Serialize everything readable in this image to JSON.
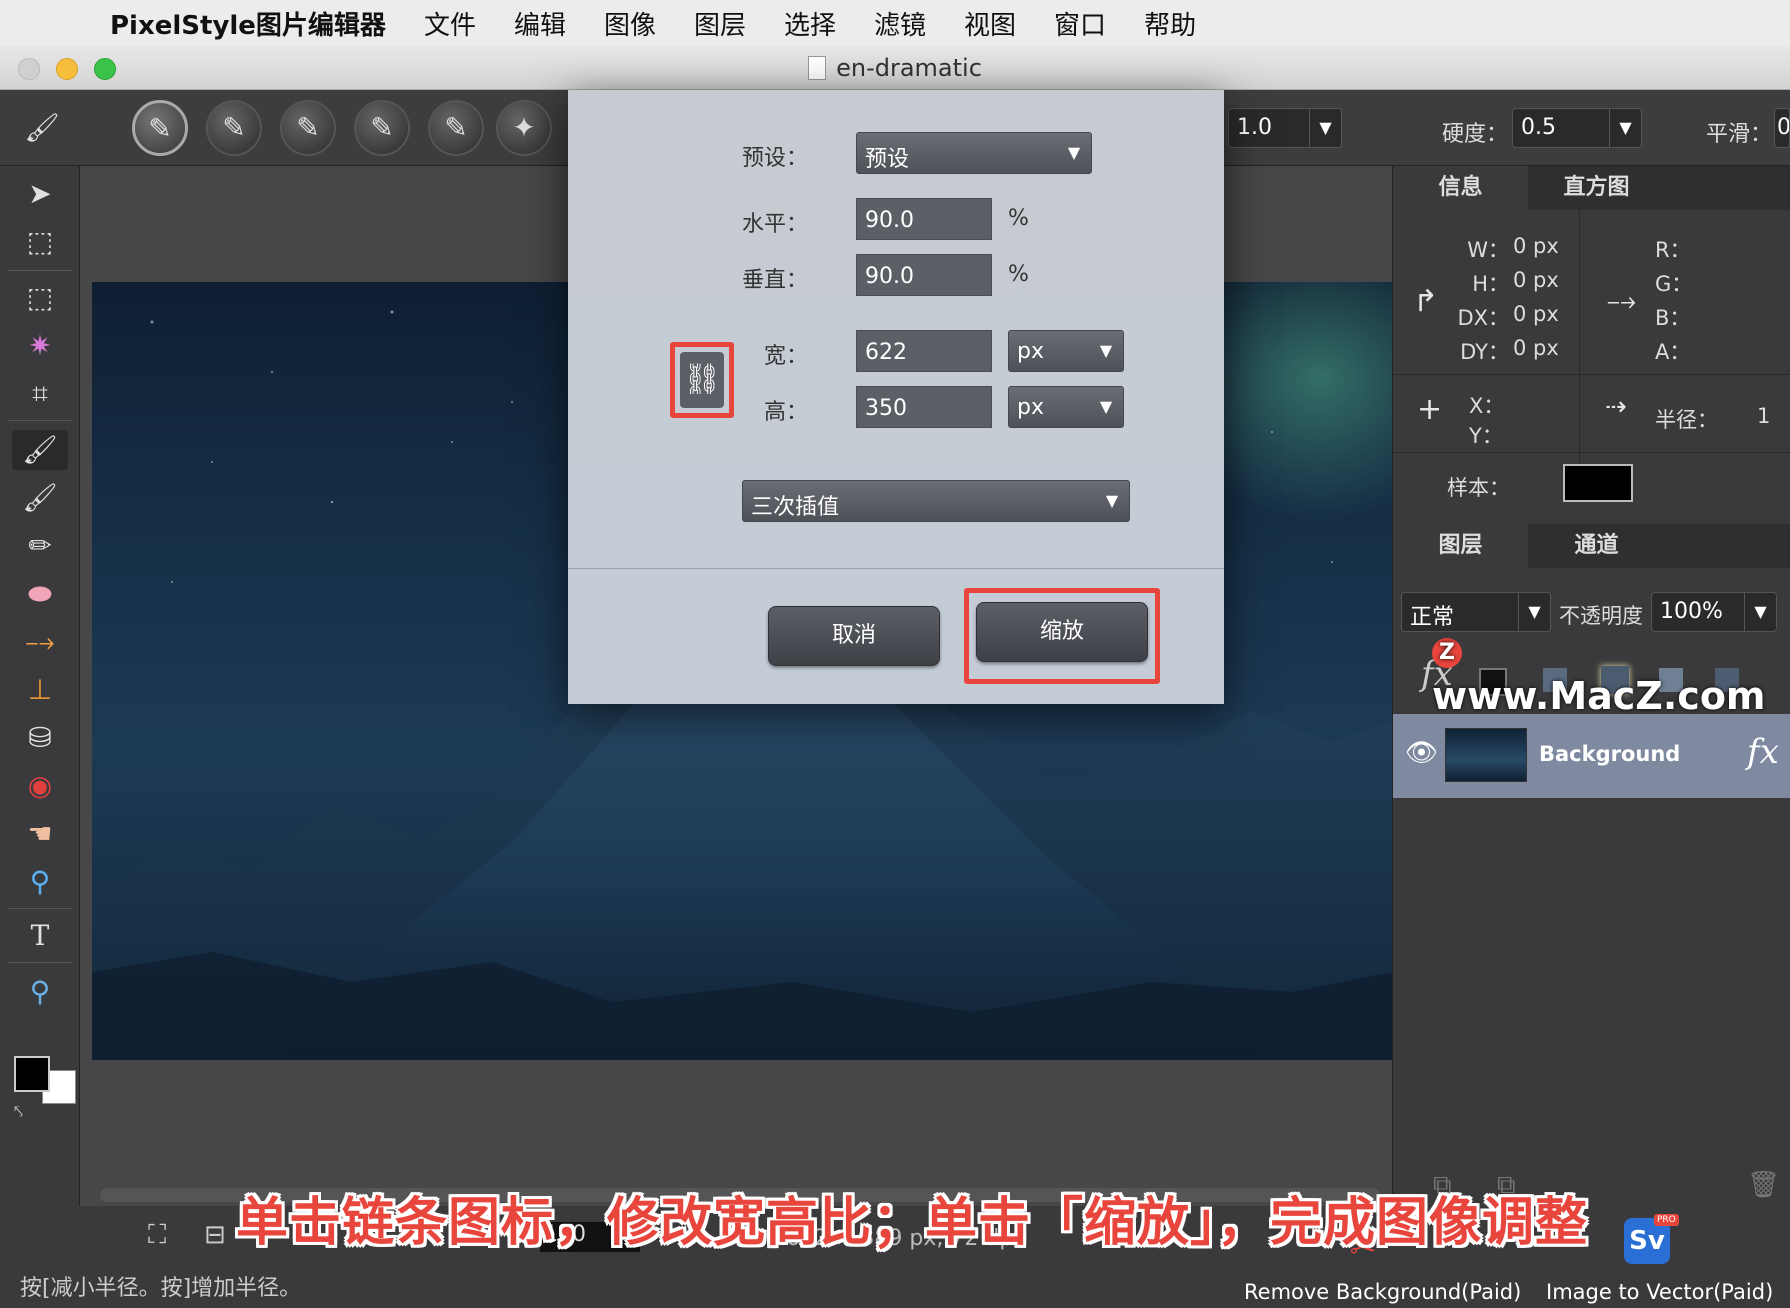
{
  "menubar": {
    "app_name": "PixelStyle图片编辑器",
    "items": [
      "文件",
      "编辑",
      "图像",
      "图层",
      "选择",
      "滤镜",
      "视图",
      "窗口",
      "帮助"
    ]
  },
  "window": {
    "title": "en-dramatic"
  },
  "options": {
    "size_value": "1.0",
    "hardness_label": "硬度：",
    "hardness_value": "0.5",
    "smooth_label": "平滑：",
    "smooth_value": "0"
  },
  "dialog": {
    "preset_label": "预设：",
    "preset_value": "预设",
    "horizontal_label": "水平：",
    "horizontal_value": "90.0",
    "horizontal_unit": "%",
    "vertical_label": "垂直：",
    "vertical_value": "90.0",
    "vertical_unit": "%",
    "width_label": "宽：",
    "width_value": "622",
    "width_unit": "px",
    "height_label": "高：",
    "height_value": "350",
    "height_unit": "px",
    "interpolation": "三次插值",
    "cancel_label": "取消",
    "scale_label": "缩放"
  },
  "info_panel": {
    "tabs": [
      "信息",
      "直方图"
    ],
    "w_label": "W：",
    "w_value": "0 px",
    "h_label": "H：",
    "h_value": "0 px",
    "dx_label": "DX：",
    "dx_value": "0 px",
    "dy_label": "DY：",
    "dy_value": "0 px",
    "r_label": "R：",
    "g_label": "G：",
    "b_label": "B：",
    "a_label": "A：",
    "x_label": "X：",
    "y_label": "Y：",
    "radius_label": "半径：",
    "radius_value": "1",
    "sample_label": "样本："
  },
  "layers_panel": {
    "tabs": [
      "图层",
      "通道"
    ],
    "blend_mode": "正常",
    "opacity_label": "不透明度",
    "opacity_value": "100%",
    "layer_name": "Background"
  },
  "status": {
    "hint": "按[减小半径。按]增加半径。",
    "zoom": "100",
    "doc_info": "692 × 389 px, 72 dpi"
  },
  "plugins": {
    "remove_bg": "Remove Background(Paid)",
    "img_to_vector": "Image to Vector(Paid)",
    "pro_badge": "PRO",
    "sv_logo": "Sv"
  },
  "overlay": {
    "caption": "单击链条图标，修改宽高比；单击「缩放」，完成图像调整",
    "watermark": "www.MacZ.com",
    "watermark_z": "Z"
  },
  "colors": {
    "highlight": "#e8453c",
    "caption_red": "#e8453c",
    "layer_selected": "#7f8aa0"
  }
}
